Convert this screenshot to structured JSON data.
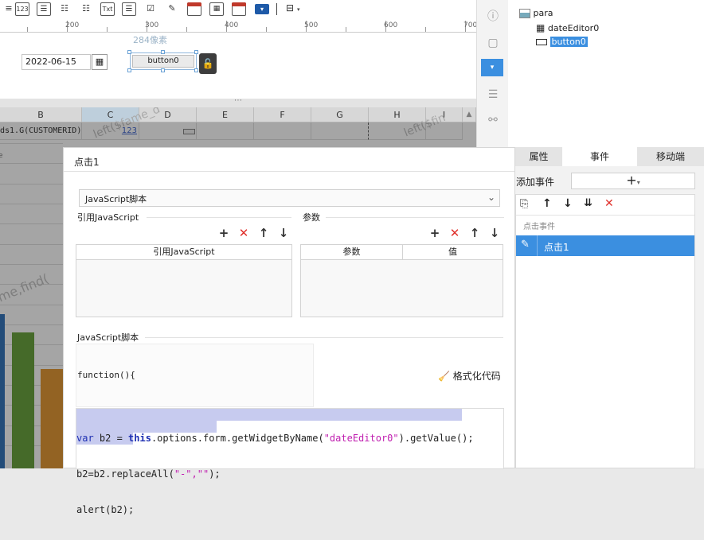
{
  "toolbar": {
    "icons": [
      "123",
      "Txt"
    ]
  },
  "ruler": {
    "labels": [
      "200",
      "300",
      "400",
      "500",
      "600",
      "700"
    ]
  },
  "canvas": {
    "size_hint": "284像素",
    "date_value": "2022-06-15",
    "button_label": "button0"
  },
  "sheet": {
    "columns": [
      "B",
      "C",
      "D",
      "E",
      "F",
      "G",
      "H",
      "I"
    ],
    "cell_b1": "ds1.G(CUSTOMERID)",
    "cell_c1": "123",
    "watermark_1": "left($fame_d",
    "watermark_2": "left($fin",
    "watermark_3": "me,find("
  },
  "tree": {
    "root": "para",
    "child_1": "dateEditor0",
    "child_2": "button0"
  },
  "dialog": {
    "title": "点击1",
    "type_select": "JavaScript脚本",
    "ref_js_title": "引用JavaScript",
    "ref_js_col": "引用JavaScript",
    "params_title": "参数",
    "params_col1": "参数",
    "params_col2": "值",
    "script_title": "JavaScript脚本",
    "func_header": "function(){",
    "format_label": "格式化代码",
    "code_line1_a": "var",
    "code_line1_b": " b2 = ",
    "code_line1_c": "this",
    "code_line1_d": ".options.form.getWidgetByName(",
    "code_line1_e": "\"dateEditor0\"",
    "code_line1_f": ").getValue();",
    "code_line2_a": "b2=b2.replaceAll(",
    "code_line2_b": "\"-\",\"\"",
    "code_line2_c": ");",
    "code_line3": "alert(b2);"
  },
  "events_panel": {
    "tabs": [
      "属性",
      "事件",
      "移动端"
    ],
    "add_event_label": "添加事件",
    "add_button": "+",
    "list_header": "点击事件",
    "selected_event": "点击1"
  },
  "colors": {
    "accent": "#3b8fe0",
    "selection": "#c7cbef",
    "delete": "#e0312c"
  }
}
